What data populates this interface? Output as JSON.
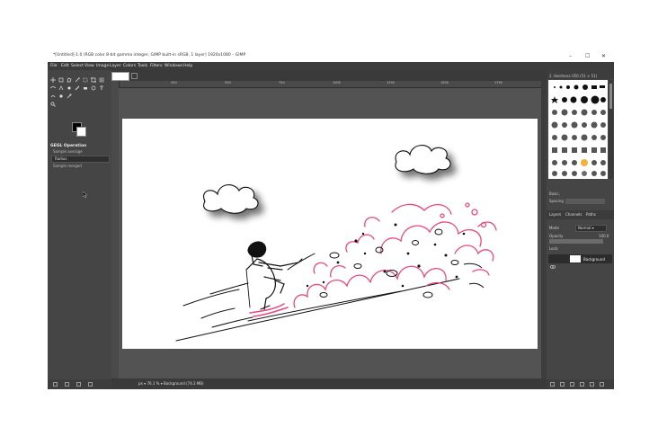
{
  "window": {
    "title": "*[Untitled]-1.0 (RGB color 8-bit gamma integer, GIMP built-in sRGB, 1 layer) 1920x1080 – GIMP",
    "controls": [
      "–",
      "☐",
      "✕"
    ]
  },
  "menu": [
    "File",
    "Edit",
    "Select",
    "View",
    "Image",
    "Layer",
    "Colors",
    "Tools",
    "Filters",
    "Windows",
    "Help"
  ],
  "tool_options": {
    "title": "GEGL Operation",
    "sample_average": "Sample average",
    "select_value": "Radius",
    "sample_merged": "Sample merged"
  },
  "ruler_ticks": [
    "250",
    "500",
    "750",
    "1000",
    "1250",
    "1500",
    "1750"
  ],
  "status": "px ▾  76.1 % ▾  Background (74.3 MB)",
  "brushes": {
    "header": "2. Hardness 050 (51 × 51)",
    "preset": "Basic,",
    "spacing": "Spacing"
  },
  "layers": {
    "tabs": [
      "Layers",
      "Channels",
      "Paths"
    ],
    "mode_label": "Mode",
    "mode_value": "Normal ▾",
    "opacity_label": "Opacity",
    "opacity_value": "100.0",
    "opacity_level": 1.0,
    "lock_label": "Lock:",
    "layer_name": "Background"
  },
  "colors": {
    "window_bg": "#454545",
    "menubar": "#3c3c3c",
    "canvas_bg": "#535353",
    "drawing_accent": "#e8497a",
    "ink": "#111111"
  }
}
